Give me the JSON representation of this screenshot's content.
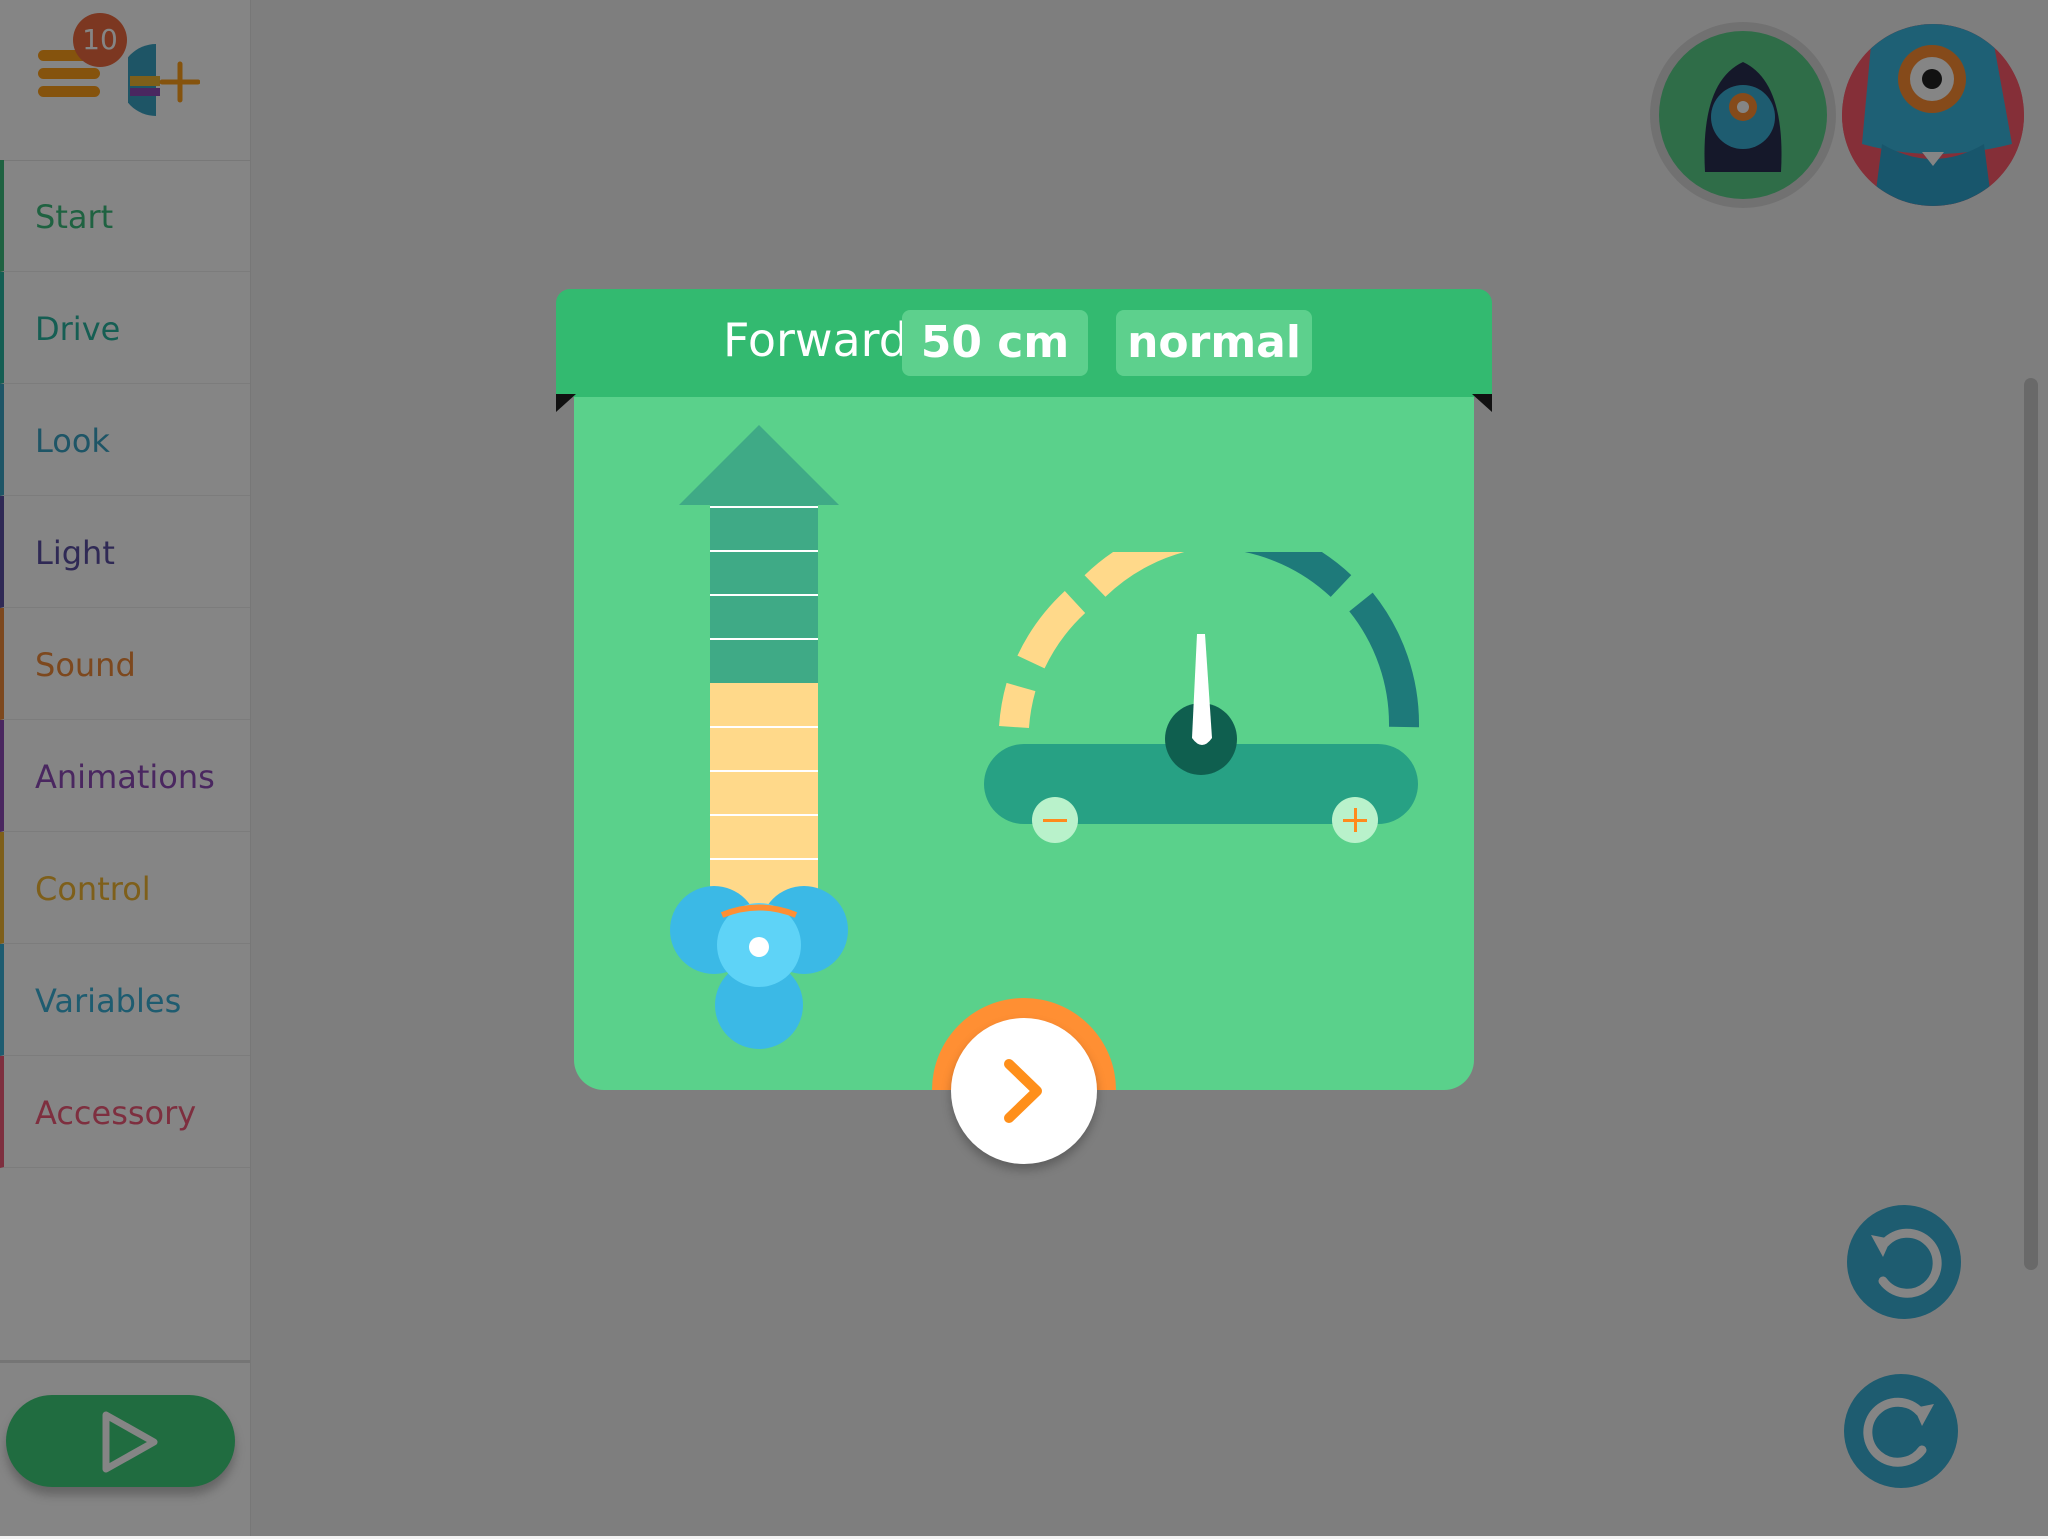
{
  "sidebar": {
    "badge_count": "10",
    "menu_icon": "hamburger-icon",
    "add_robot_icon": "add-robot-icon",
    "categories": [
      {
        "label": "Start",
        "color": "#3dbd7d"
      },
      {
        "label": "Drive",
        "color": "#2ab5a0"
      },
      {
        "label": "Look",
        "color": "#3aa3c4"
      },
      {
        "label": "Light",
        "color": "#5b4fa3"
      },
      {
        "label": "Sound",
        "color": "#f08a3a"
      },
      {
        "label": "Animations",
        "color": "#8e4bb8"
      },
      {
        "label": "Control",
        "color": "#f2b632"
      },
      {
        "label": "Variables",
        "color": "#3bb0d6"
      },
      {
        "label": "Accessory",
        "color": "#f25a7a"
      }
    ],
    "play_icon": "play-icon"
  },
  "robots": {
    "dot_icon": "dot-robot-avatar",
    "dash_icon": "dash-robot-avatar"
  },
  "history": {
    "undo_icon": "undo-icon",
    "redo_icon": "redo-icon"
  },
  "modal": {
    "title": "Forward",
    "distance": "50 cm",
    "speed": "normal",
    "distance_level": 0.5,
    "speed_level": 0.5,
    "next_icon": "chevron-right-icon",
    "colors": {
      "header": "#33ba70",
      "body": "#5ad18b",
      "accent": "#ff8f33",
      "slow": "#ffd98a",
      "fast": "#1e7a7a"
    }
  }
}
